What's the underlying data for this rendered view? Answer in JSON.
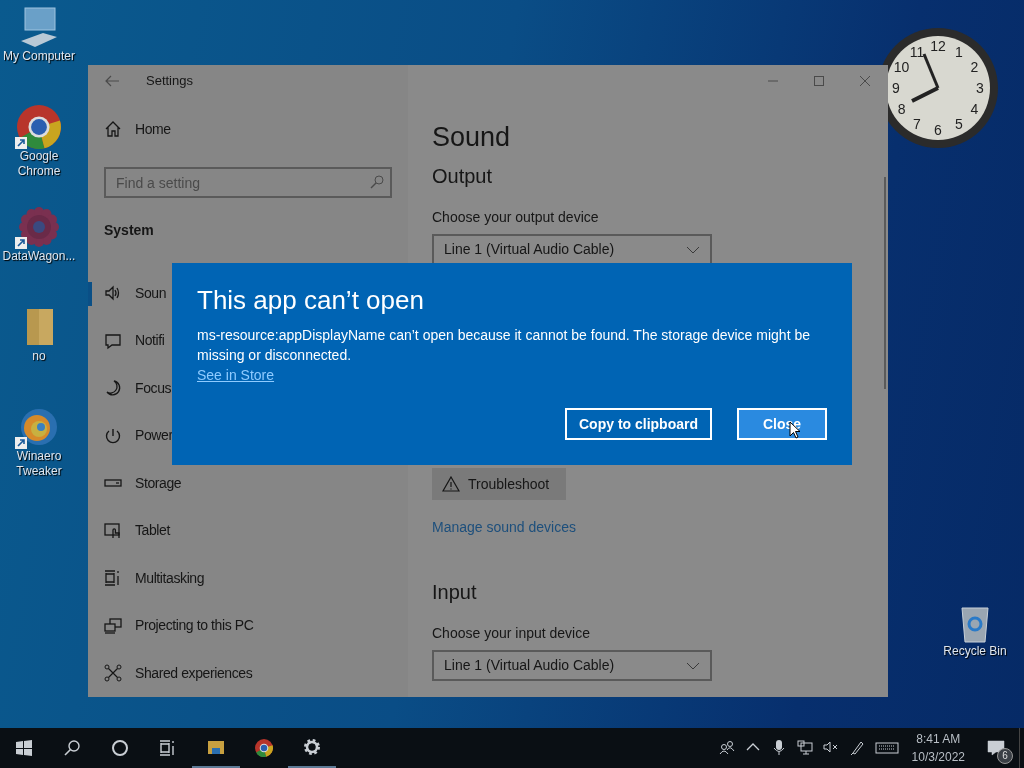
{
  "desktop_icons": [
    {
      "label": "My Computer",
      "kind": "computer",
      "shortcut": false
    },
    {
      "label": "Google Chrome",
      "kind": "chrome",
      "shortcut": true
    },
    {
      "label": "DataWagon...",
      "kind": "gear",
      "shortcut": true
    },
    {
      "label": "no",
      "kind": "folder",
      "shortcut": false
    },
    {
      "label": "Winaero Tweaker",
      "kind": "swirl",
      "shortcut": true
    },
    {
      "label": "Recycle Bin",
      "kind": "bin",
      "shortcut": false
    }
  ],
  "clock": {
    "numerals": [
      "12",
      "11",
      "1",
      "10",
      "2",
      "9",
      "3",
      "8",
      "4",
      "7",
      "5",
      "6"
    ]
  },
  "settings_window": {
    "title": "Settings",
    "sidebar": {
      "home": "Home",
      "search": {
        "placeholder": "Find a setting"
      },
      "section": "System",
      "items": [
        {
          "label": "Soun",
          "kind": "sound",
          "selected": true
        },
        {
          "label": "Notifi",
          "kind": "notifications",
          "selected": false
        },
        {
          "label": "Focus",
          "kind": "focus",
          "selected": false
        },
        {
          "label": "Power",
          "kind": "power",
          "selected": false
        },
        {
          "label": "Storage",
          "kind": "storage",
          "selected": false
        },
        {
          "label": "Tablet",
          "kind": "tablet",
          "selected": false
        },
        {
          "label": "Multitasking",
          "kind": "multitasking",
          "selected": false
        },
        {
          "label": "Projecting to this PC",
          "kind": "projecting",
          "selected": false
        },
        {
          "label": "Shared experiences",
          "kind": "shared",
          "selected": false
        }
      ]
    },
    "page": {
      "title": "Sound",
      "output": {
        "heading": "Output",
        "label": "Choose your output device",
        "device": "Line 1 (Virtual Audio Cable)"
      },
      "troubleshoot": "Troubleshoot",
      "manage_link": "Manage sound devices",
      "input": {
        "heading": "Input",
        "label": "Choose your input device",
        "device": "Line 1 (Virtual Audio Cable)"
      }
    }
  },
  "dialog": {
    "title": "This app can’t open",
    "message": "ms-resource:appDisplayName can’t open because it cannot be found. The storage device might be missing or disconnected.",
    "link": "See in Store",
    "buttons": [
      {
        "label": "Copy to clipboard",
        "selected": false
      },
      {
        "label": "Close",
        "selected": true
      }
    ]
  },
  "taskbar": {
    "apps": [
      {
        "kind": "start",
        "running": false
      },
      {
        "kind": "search",
        "running": false
      },
      {
        "kind": "cortana",
        "running": false
      },
      {
        "kind": "taskview",
        "running": false
      },
      {
        "kind": "explorer",
        "running": true
      },
      {
        "kind": "chrome",
        "running": false
      },
      {
        "kind": "settings",
        "running": true
      }
    ],
    "tray": [
      {
        "kind": "people"
      },
      {
        "kind": "chevron"
      },
      {
        "kind": "mic"
      },
      {
        "kind": "network"
      },
      {
        "kind": "muted"
      },
      {
        "kind": "pen"
      },
      {
        "kind": "keyboard"
      }
    ],
    "time": "8:41 AM",
    "date": "10/3/2022",
    "notification_count": "6"
  }
}
